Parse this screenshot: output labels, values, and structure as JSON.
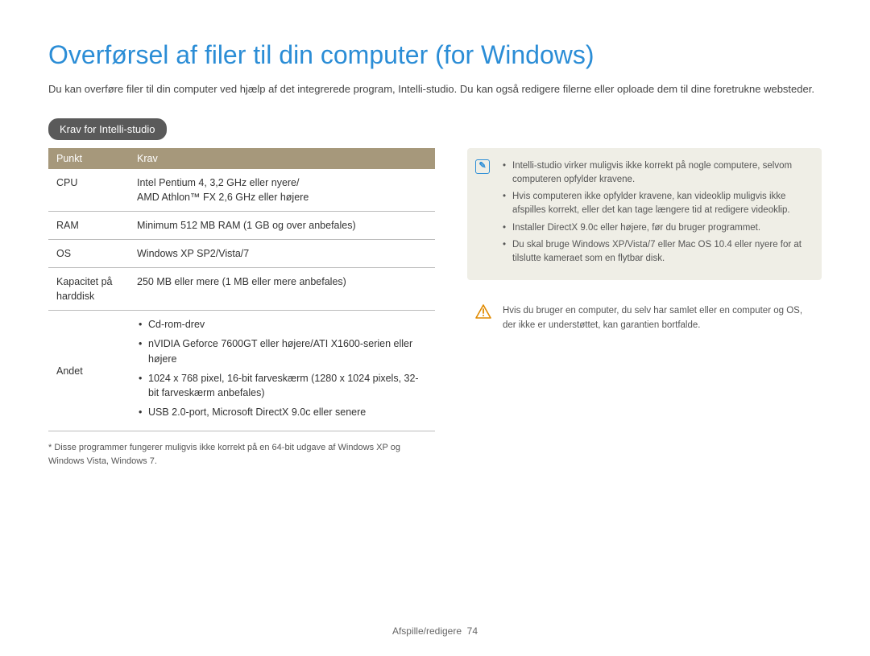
{
  "title": "Overførsel af filer til din computer (for Windows)",
  "intro": "Du kan overføre filer til din computer ved hjælp af det integrerede program, Intelli-studio. Du kan også redigere filerne eller oploade dem til dine foretrukne websteder.",
  "section_heading": "Krav for Intelli-studio",
  "table": {
    "header": {
      "col1": "Punkt",
      "col2": "Krav"
    },
    "rows": {
      "cpu": {
        "label": "CPU",
        "value": "Intel Pentium 4, 3,2 GHz eller nyere/\nAMD Athlon™ FX 2,6 GHz eller højere"
      },
      "ram": {
        "label": "RAM",
        "value": "Minimum 512 MB RAM (1 GB og over anbefales)"
      },
      "os": {
        "label": "OS",
        "value": "Windows XP SP2/Vista/7"
      },
      "hdd": {
        "label": "Kapacitet på harddisk",
        "value": "250 MB eller mere (1 MB eller mere anbefales)"
      },
      "other": {
        "label": "Andet",
        "items": [
          "Cd-rom-drev",
          "nVIDIA Geforce 7600GT eller højere/ATI X1600-serien eller højere",
          "1024 x 768 pixel, 16-bit farveskærm (1280 x 1024 pixels, 32-bit farveskærm anbefales)",
          "USB 2.0-port, Microsoft DirectX 9.0c eller senere"
        ]
      }
    }
  },
  "footnote": "* Disse programmer fungerer muligvis ikke korrekt på en 64-bit udgave af Windows XP og Windows Vista, Windows 7.",
  "info_notes": [
    "Intelli-studio virker muligvis ikke korrekt på nogle computere, selvom computeren opfylder kravene.",
    "Hvis computeren ikke opfylder kravene, kan videoklip muligvis ikke afspilles korrekt, eller det kan tage længere tid at redigere videoklip.",
    "Installer DirectX 9.0c eller højere, før du bruger programmet.",
    "Du skal bruge Windows XP/Vista/7 eller Mac OS 10.4 eller nyere for at tilslutte kameraet som en flytbar disk."
  ],
  "warning": "Hvis du bruger en computer, du selv har samlet eller en computer og OS, der ikke er understøttet, kan garantien bortfalde.",
  "footer": {
    "section": "Afspille/redigere",
    "page": "74"
  }
}
